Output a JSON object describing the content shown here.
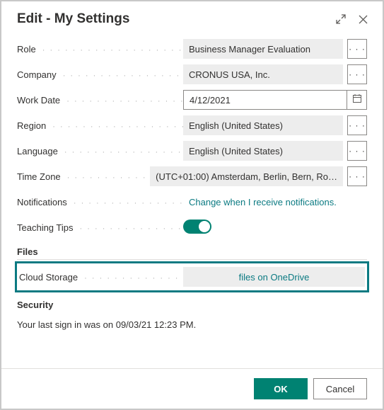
{
  "header": {
    "title": "Edit - My Settings"
  },
  "fields": {
    "role": {
      "label": "Role",
      "value": "Business Manager Evaluation"
    },
    "company": {
      "label": "Company",
      "value": "CRONUS USA, Inc."
    },
    "workDate": {
      "label": "Work Date",
      "value": "4/12/2021"
    },
    "region": {
      "label": "Region",
      "value": "English (United States)"
    },
    "language": {
      "label": "Language",
      "value": "English (United States)"
    },
    "timeZone": {
      "label": "Time Zone",
      "value": "(UTC+01:00) Amsterdam, Berlin, Bern, Ro…"
    },
    "notifications": {
      "label": "Notifications",
      "value": "Change when I receive notifications."
    },
    "teachingTips": {
      "label": "Teaching Tips"
    },
    "cloudStorage": {
      "label": "Cloud Storage",
      "value": "files on OneDrive"
    }
  },
  "sections": {
    "files": "Files",
    "security": "Security"
  },
  "securityText": "Your last sign in was on 09/03/21 12:23 PM.",
  "buttons": {
    "ok": "OK",
    "cancel": "Cancel",
    "more": "· · ·"
  }
}
